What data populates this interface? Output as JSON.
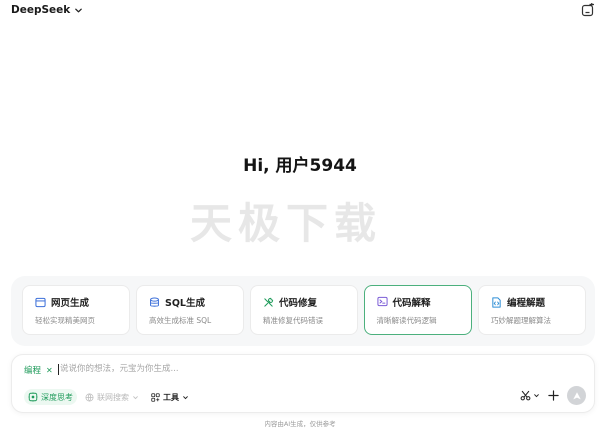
{
  "header": {
    "brand": "DeepSeek"
  },
  "greeting": "Hi, 用户5944",
  "watermark": "天极下载",
  "cards": [
    {
      "title": "网页生成",
      "subtitle": "轻松实现精美网页",
      "icon": "webpage-icon"
    },
    {
      "title": "SQL生成",
      "subtitle": "高效生成标准 SQL",
      "icon": "database-icon"
    },
    {
      "title": "代码修复",
      "subtitle": "精准修复代码错误",
      "icon": "tools-icon"
    },
    {
      "title": "代码解释",
      "subtitle": "清晰解读代码逻辑",
      "icon": "terminal-icon"
    },
    {
      "title": "编程解题",
      "subtitle": "巧妙解题理解算法",
      "icon": "code-file-icon"
    }
  ],
  "composer": {
    "tag": "编程",
    "placeholder": "说说你的想法，元宝为你生成...",
    "deep_think": "深度思考",
    "web_search": "联网搜索",
    "tools": "工具"
  },
  "disclaimer": "内容由AI生成，仅供参考",
  "colors": {
    "accent_green": "#1f9b5b",
    "active_border": "#4cb07d",
    "send_bg": "#d2d4d7"
  }
}
